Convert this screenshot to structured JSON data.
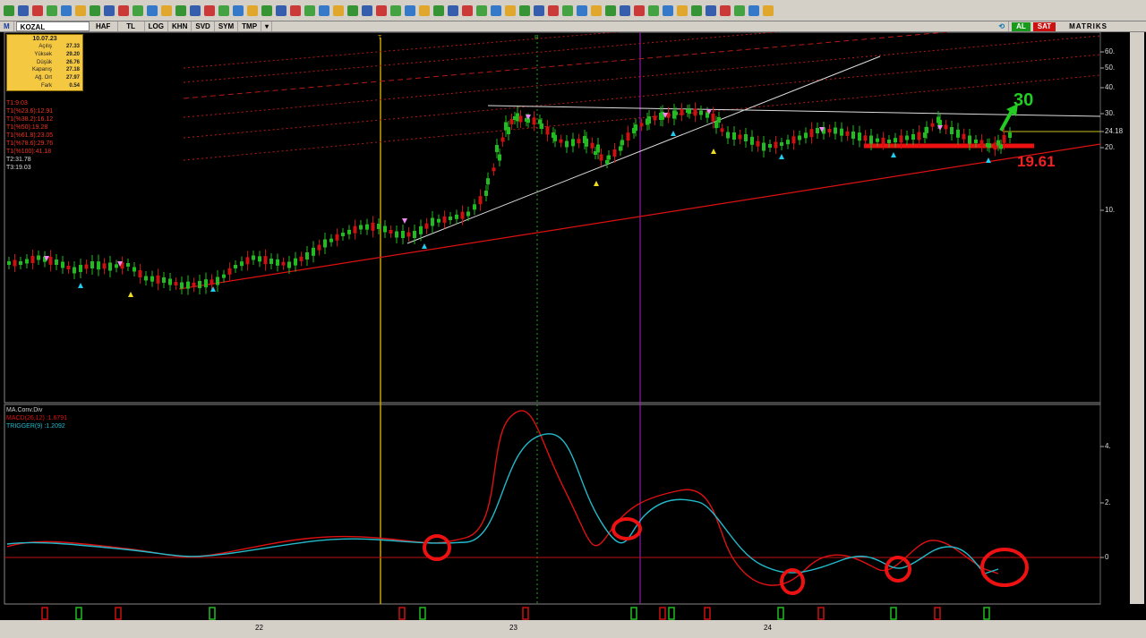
{
  "toolbar": {
    "icons": [
      "lock-icon",
      "cursor-icon",
      "cursor-icon",
      "crosshair-icon",
      "line-icon",
      "fibonacci-icon",
      "magnet-icon",
      "erase-icon",
      "equal-lines-icon",
      "equal-lines-icon",
      "equal-lines-icon",
      "text-icon",
      "line-icon",
      "pencil-icon",
      "pencil-icon",
      "pencil-icon",
      "pencil-icon",
      "pencil-icon",
      "ruler-icon",
      "shape-icon",
      "shape-icon",
      "shape-icon",
      "shape-icon",
      "shape-icon",
      "shape-icon",
      "shape-icon",
      "shape-icon",
      "channel-icon",
      "channel-icon",
      "channel-icon",
      "channel-icon",
      "channel-icon",
      "channel-icon",
      "grid-icon",
      "chain-icon",
      "chain-icon",
      "chain-icon",
      "chain-icon",
      "speech-icon",
      "note-icon",
      "smiley-icon",
      "arrow-icon",
      "arrow-icon",
      "arrow-icon",
      "arrow-icon",
      "arrow-icon",
      "arrow-icon",
      "arrow-icon",
      "arrow-icon",
      "arrow-icon",
      "zoom-icon",
      "zoom-icon",
      "image-icon",
      "chart-icon"
    ]
  },
  "secbar": {
    "mode_icon": "M",
    "symbol": "KOZAL",
    "period": "HAF",
    "currency": "TL",
    "scale": "LOG",
    "khn": "KHN",
    "svd": "SVD",
    "sym": "SYM",
    "tmp": "TMP",
    "buy": "AL",
    "sell": "SAT",
    "brand": "MATRIKS"
  },
  "infobox": {
    "date": "10.07.23",
    "rows": [
      {
        "label": "Açılış",
        "value": "27.33"
      },
      {
        "label": "Yüksek",
        "value": "29.20"
      },
      {
        "label": "Düşük",
        "value": "26.76"
      },
      {
        "label": "Kapanış",
        "value": "27.18"
      },
      {
        "label": "Ağ. Ort",
        "value": "27.97"
      },
      {
        "label": "Fark",
        "value": "0.54"
      }
    ]
  },
  "fib": {
    "lines": [
      "T1:9.03",
      "T1(%23.6):12.91",
      "T1(%38.2):16.12",
      "T1(%50):19.28",
      "T1(%61.8):23.05",
      "T1(%78.6):29.76",
      "T1(%100):41.18"
    ],
    "t2": "T2:31.78",
    "t3": "T3:19.03"
  },
  "axis": {
    "price": [
      {
        "label": "60.",
        "y": 58
      },
      {
        "label": "50.",
        "y": 76
      },
      {
        "label": "40.",
        "y": 98
      },
      {
        "label": "30.",
        "y": 127
      },
      {
        "label": "24.18",
        "y": 147
      },
      {
        "label": "20.",
        "y": 165
      },
      {
        "label": "10.",
        "y": 235
      }
    ],
    "macd": [
      {
        "label": "4.",
        "y": 499
      },
      {
        "label": "2.",
        "y": 562
      },
      {
        "label": "0",
        "y": 623
      }
    ],
    "x": [
      {
        "label": "22",
        "x": 285
      },
      {
        "label": "23",
        "x": 569
      },
      {
        "label": "24",
        "x": 853
      }
    ]
  },
  "macd_panel": {
    "title": "MA.Conv.Div",
    "macd": "MACD(26,12) :1.6791",
    "trigger": "TRIGGER(9) :1.2092"
  },
  "markers": {
    "v_yellow": "T",
    "v_green": "B"
  },
  "annotations": {
    "target": "30",
    "support": "19.61"
  },
  "colors": {
    "bg": "#000000",
    "toolbar": "#d4d0c8",
    "bull": "#22bb22",
    "bear": "#cc1111",
    "macd": "#dd1111",
    "trigger": "#22bbcc",
    "fib": "#cc2222",
    "info_bg": "#f5c842"
  },
  "chart_data": {
    "type": "line",
    "title": "",
    "series": [
      {
        "name": "MACD(26,12)",
        "last": 1.6791
      },
      {
        "name": "TRIGGER(9)",
        "last": 1.2092
      }
    ]
  }
}
